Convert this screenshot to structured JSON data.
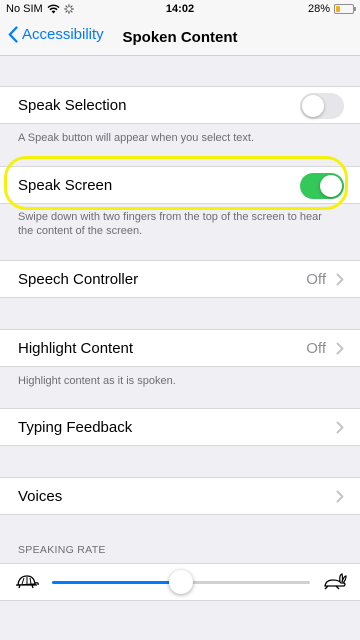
{
  "status_bar": {
    "carrier": "No SIM",
    "time": "14:02",
    "battery": "28%",
    "battery_level": 0.28,
    "battery_color": "#f2b01e"
  },
  "nav": {
    "back_label": "Accessibility",
    "title": "Spoken Content"
  },
  "speak_selection": {
    "label": "Speak Selection",
    "enabled": false,
    "footer": "A Speak button will appear when you select text."
  },
  "speak_screen": {
    "label": "Speak Screen",
    "enabled": true,
    "footer": "Swipe down with two fingers from the top of the screen to hear the content of the screen."
  },
  "speech_controller": {
    "label": "Speech Controller",
    "value": "Off"
  },
  "highlight_content": {
    "label": "Highlight Content",
    "value": "Off",
    "footer": "Highlight content as it is spoken."
  },
  "typing_feedback": {
    "label": "Typing Feedback"
  },
  "voices": {
    "label": "Voices"
  },
  "speaking_rate": {
    "header": "SPEAKING RATE",
    "value": 0.5
  },
  "colors": {
    "accent": "#007aff",
    "toggle_on": "#34c759",
    "highlight_ring": "#f5f10c"
  }
}
